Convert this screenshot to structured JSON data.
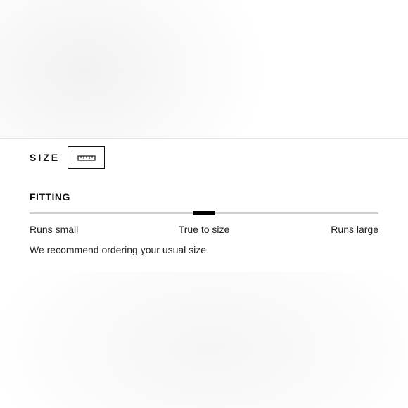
{
  "size_section": {
    "title": "SIZE",
    "guide_icon": "ruler-icon"
  },
  "fitting": {
    "title": "FITTING",
    "scale_position": 0.5,
    "labels": {
      "small": "Runs small",
      "true": "True to size",
      "large": "Runs large"
    },
    "recommendation": "We recommend ordering your usual size"
  },
  "colors": {
    "text": "#111111",
    "track": "#cfcfcf",
    "marker": "#000000"
  }
}
